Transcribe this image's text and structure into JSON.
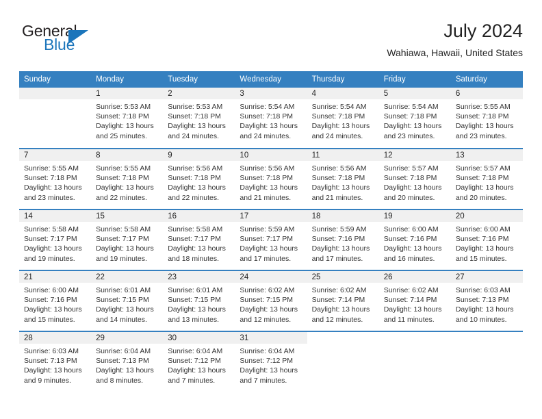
{
  "brand": {
    "name_part1": "General",
    "name_part2": "Blue",
    "accent_color": "#1b75bb"
  },
  "header": {
    "title": "July 2024",
    "subtitle": "Wahiawa, Hawaii, United States"
  },
  "calendar": {
    "header_color": "#3580c0",
    "day_band_color": "#f0f0f0",
    "weekdays": [
      "Sunday",
      "Monday",
      "Tuesday",
      "Wednesday",
      "Thursday",
      "Friday",
      "Saturday"
    ],
    "weeks": [
      [
        {
          "day": "",
          "sunrise": "",
          "sunset": "",
          "daylight": "",
          "empty": true
        },
        {
          "day": "1",
          "sunrise": "Sunrise: 5:53 AM",
          "sunset": "Sunset: 7:18 PM",
          "daylight": "Daylight: 13 hours and 25 minutes."
        },
        {
          "day": "2",
          "sunrise": "Sunrise: 5:53 AM",
          "sunset": "Sunset: 7:18 PM",
          "daylight": "Daylight: 13 hours and 24 minutes."
        },
        {
          "day": "3",
          "sunrise": "Sunrise: 5:54 AM",
          "sunset": "Sunset: 7:18 PM",
          "daylight": "Daylight: 13 hours and 24 minutes."
        },
        {
          "day": "4",
          "sunrise": "Sunrise: 5:54 AM",
          "sunset": "Sunset: 7:18 PM",
          "daylight": "Daylight: 13 hours and 24 minutes."
        },
        {
          "day": "5",
          "sunrise": "Sunrise: 5:54 AM",
          "sunset": "Sunset: 7:18 PM",
          "daylight": "Daylight: 13 hours and 23 minutes."
        },
        {
          "day": "6",
          "sunrise": "Sunrise: 5:55 AM",
          "sunset": "Sunset: 7:18 PM",
          "daylight": "Daylight: 13 hours and 23 minutes."
        }
      ],
      [
        {
          "day": "7",
          "sunrise": "Sunrise: 5:55 AM",
          "sunset": "Sunset: 7:18 PM",
          "daylight": "Daylight: 13 hours and 23 minutes."
        },
        {
          "day": "8",
          "sunrise": "Sunrise: 5:55 AM",
          "sunset": "Sunset: 7:18 PM",
          "daylight": "Daylight: 13 hours and 22 minutes."
        },
        {
          "day": "9",
          "sunrise": "Sunrise: 5:56 AM",
          "sunset": "Sunset: 7:18 PM",
          "daylight": "Daylight: 13 hours and 22 minutes."
        },
        {
          "day": "10",
          "sunrise": "Sunrise: 5:56 AM",
          "sunset": "Sunset: 7:18 PM",
          "daylight": "Daylight: 13 hours and 21 minutes."
        },
        {
          "day": "11",
          "sunrise": "Sunrise: 5:56 AM",
          "sunset": "Sunset: 7:18 PM",
          "daylight": "Daylight: 13 hours and 21 minutes."
        },
        {
          "day": "12",
          "sunrise": "Sunrise: 5:57 AM",
          "sunset": "Sunset: 7:18 PM",
          "daylight": "Daylight: 13 hours and 20 minutes."
        },
        {
          "day": "13",
          "sunrise": "Sunrise: 5:57 AM",
          "sunset": "Sunset: 7:18 PM",
          "daylight": "Daylight: 13 hours and 20 minutes."
        }
      ],
      [
        {
          "day": "14",
          "sunrise": "Sunrise: 5:58 AM",
          "sunset": "Sunset: 7:17 PM",
          "daylight": "Daylight: 13 hours and 19 minutes."
        },
        {
          "day": "15",
          "sunrise": "Sunrise: 5:58 AM",
          "sunset": "Sunset: 7:17 PM",
          "daylight": "Daylight: 13 hours and 19 minutes."
        },
        {
          "day": "16",
          "sunrise": "Sunrise: 5:58 AM",
          "sunset": "Sunset: 7:17 PM",
          "daylight": "Daylight: 13 hours and 18 minutes."
        },
        {
          "day": "17",
          "sunrise": "Sunrise: 5:59 AM",
          "sunset": "Sunset: 7:17 PM",
          "daylight": "Daylight: 13 hours and 17 minutes."
        },
        {
          "day": "18",
          "sunrise": "Sunrise: 5:59 AM",
          "sunset": "Sunset: 7:16 PM",
          "daylight": "Daylight: 13 hours and 17 minutes."
        },
        {
          "day": "19",
          "sunrise": "Sunrise: 6:00 AM",
          "sunset": "Sunset: 7:16 PM",
          "daylight": "Daylight: 13 hours and 16 minutes."
        },
        {
          "day": "20",
          "sunrise": "Sunrise: 6:00 AM",
          "sunset": "Sunset: 7:16 PM",
          "daylight": "Daylight: 13 hours and 15 minutes."
        }
      ],
      [
        {
          "day": "21",
          "sunrise": "Sunrise: 6:00 AM",
          "sunset": "Sunset: 7:16 PM",
          "daylight": "Daylight: 13 hours and 15 minutes."
        },
        {
          "day": "22",
          "sunrise": "Sunrise: 6:01 AM",
          "sunset": "Sunset: 7:15 PM",
          "daylight": "Daylight: 13 hours and 14 minutes."
        },
        {
          "day": "23",
          "sunrise": "Sunrise: 6:01 AM",
          "sunset": "Sunset: 7:15 PM",
          "daylight": "Daylight: 13 hours and 13 minutes."
        },
        {
          "day": "24",
          "sunrise": "Sunrise: 6:02 AM",
          "sunset": "Sunset: 7:15 PM",
          "daylight": "Daylight: 13 hours and 12 minutes."
        },
        {
          "day": "25",
          "sunrise": "Sunrise: 6:02 AM",
          "sunset": "Sunset: 7:14 PM",
          "daylight": "Daylight: 13 hours and 12 minutes."
        },
        {
          "day": "26",
          "sunrise": "Sunrise: 6:02 AM",
          "sunset": "Sunset: 7:14 PM",
          "daylight": "Daylight: 13 hours and 11 minutes."
        },
        {
          "day": "27",
          "sunrise": "Sunrise: 6:03 AM",
          "sunset": "Sunset: 7:13 PM",
          "daylight": "Daylight: 13 hours and 10 minutes."
        }
      ],
      [
        {
          "day": "28",
          "sunrise": "Sunrise: 6:03 AM",
          "sunset": "Sunset: 7:13 PM",
          "daylight": "Daylight: 13 hours and 9 minutes."
        },
        {
          "day": "29",
          "sunrise": "Sunrise: 6:04 AM",
          "sunset": "Sunset: 7:13 PM",
          "daylight": "Daylight: 13 hours and 8 minutes."
        },
        {
          "day": "30",
          "sunrise": "Sunrise: 6:04 AM",
          "sunset": "Sunset: 7:12 PM",
          "daylight": "Daylight: 13 hours and 7 minutes."
        },
        {
          "day": "31",
          "sunrise": "Sunrise: 6:04 AM",
          "sunset": "Sunset: 7:12 PM",
          "daylight": "Daylight: 13 hours and 7 minutes."
        },
        {
          "day": "",
          "sunrise": "",
          "sunset": "",
          "daylight": "",
          "empty": true,
          "blank": true
        },
        {
          "day": "",
          "sunrise": "",
          "sunset": "",
          "daylight": "",
          "empty": true,
          "blank": true
        },
        {
          "day": "",
          "sunrise": "",
          "sunset": "",
          "daylight": "",
          "empty": true,
          "blank": true
        }
      ]
    ]
  }
}
